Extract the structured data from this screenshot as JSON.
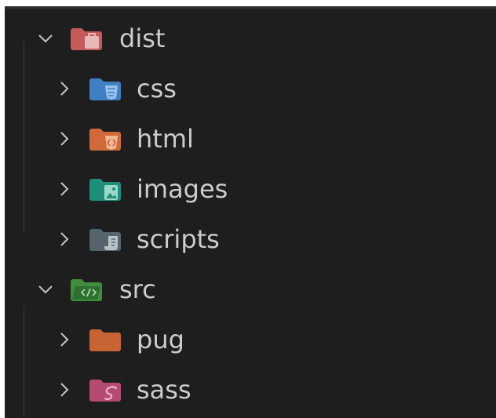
{
  "explorer": {
    "items": [
      {
        "label": "dist",
        "expanded": true,
        "level": 0,
        "icon": "folder-dist-icon",
        "color": "#c45a5a"
      },
      {
        "label": "css",
        "expanded": false,
        "level": 1,
        "icon": "folder-css-icon",
        "color": "#3f7fc4"
      },
      {
        "label": "html",
        "expanded": false,
        "level": 1,
        "icon": "folder-html-icon",
        "color": "#d2693a"
      },
      {
        "label": "images",
        "expanded": false,
        "level": 1,
        "icon": "folder-images-icon",
        "color": "#1f8f7a"
      },
      {
        "label": "scripts",
        "expanded": false,
        "level": 1,
        "icon": "folder-scripts-icon",
        "color": "#56646e"
      },
      {
        "label": "src",
        "expanded": true,
        "level": 0,
        "icon": "folder-src-icon",
        "color": "#3e8e3e"
      },
      {
        "label": "pug",
        "expanded": false,
        "level": 1,
        "icon": "folder-pug-icon",
        "color": "#c86434"
      },
      {
        "label": "sass",
        "expanded": false,
        "level": 1,
        "icon": "folder-sass-icon",
        "color": "#b54a72"
      }
    ]
  }
}
